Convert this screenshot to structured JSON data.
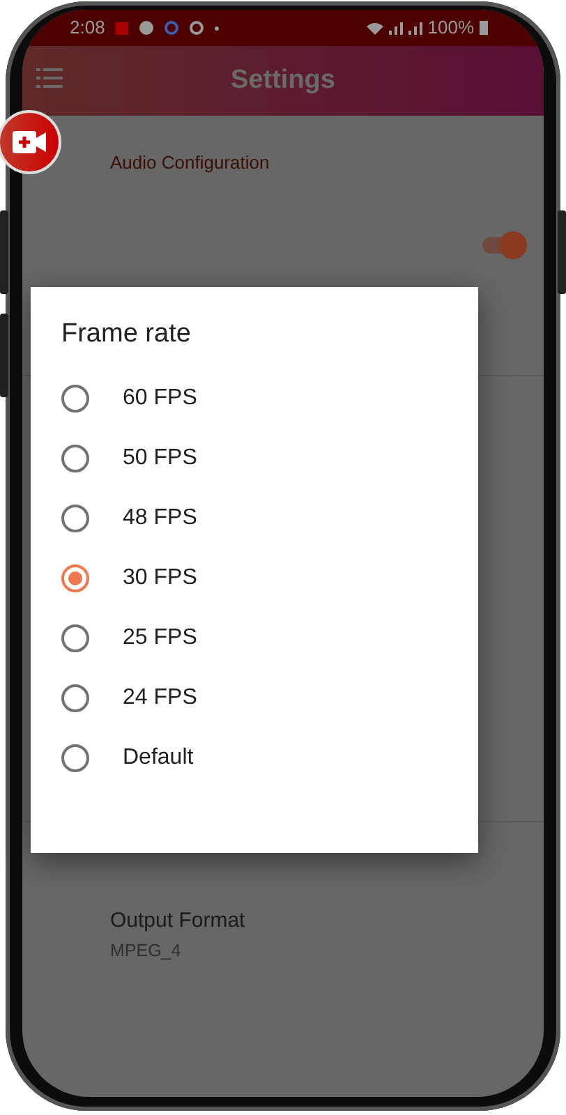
{
  "status_bar": {
    "time": "2:08",
    "battery": "100%"
  },
  "app_bar": {
    "title": "Settings"
  },
  "sections": [
    {
      "kind": "header",
      "title": "Audio Configuration"
    },
    {
      "kind": "toggle",
      "on": true
    },
    {
      "kind": "divider"
    },
    {
      "kind": "item",
      "title": "Output Format",
      "value": "MPEG_4"
    }
  ],
  "dialog": {
    "title": "Frame rate",
    "options": [
      {
        "label": "60 FPS",
        "selected": false
      },
      {
        "label": "50 FPS",
        "selected": false
      },
      {
        "label": "48 FPS",
        "selected": false
      },
      {
        "label": "30 FPS",
        "selected": true
      },
      {
        "label": "25 FPS",
        "selected": false
      },
      {
        "label": "24 FPS",
        "selected": false
      },
      {
        "label": "Default",
        "selected": false
      }
    ]
  }
}
